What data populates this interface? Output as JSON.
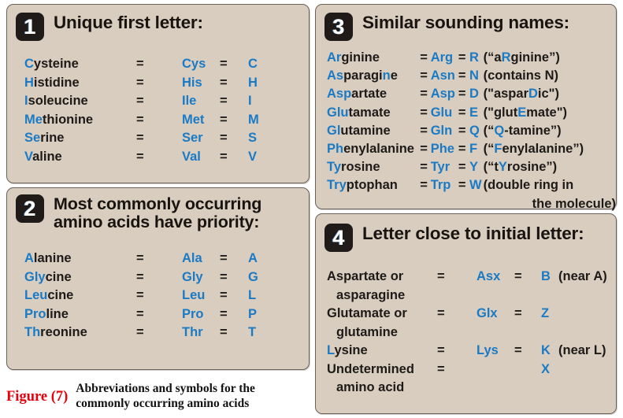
{
  "figure": {
    "label": "Figure (7)",
    "caption_line1": "Abbreviations and symbols for the",
    "caption_line2": "commonly occurring amino acids",
    "label_color": "#e8000d"
  },
  "colors": {
    "panel_background": "#d9cdc0",
    "panel_border": "#6d6258",
    "badge_background": "#201b18",
    "accent_blue": "#1b7ac4",
    "text_dark": "#1d1a17",
    "page_background": "#ffffff"
  },
  "panels": [
    {
      "number": "1",
      "title": "Unique first letter:",
      "rows": [
        {
          "prefix": "C",
          "rest": "ysteine",
          "eq1": "=",
          "abbr": "Cys",
          "eq2": "=",
          "letter": "C"
        },
        {
          "prefix": "H",
          "rest": "istidine",
          "eq1": "=",
          "abbr": "His",
          "eq2": "=",
          "letter": "H"
        },
        {
          "prefix": "I",
          "rest": "soleucine",
          "eq1": "=",
          "abbr": "Ile",
          "eq2": "=",
          "letter": "I"
        },
        {
          "prefix": "Me",
          "rest": "thionine",
          "eq1": "=",
          "abbr": "Met",
          "eq2": "=",
          "letter": "M"
        },
        {
          "prefix": "Se",
          "rest": "rine",
          "eq1": "=",
          "abbr": "Ser",
          "eq2": "=",
          "letter": "S"
        },
        {
          "prefix": "V",
          "rest": "aline",
          "eq1": "=",
          "abbr": "Val",
          "eq2": "=",
          "letter": "V"
        }
      ]
    },
    {
      "number": "2",
      "title_line1": "Most commonly occurring",
      "title_line2": "amino acids have priority:",
      "rows": [
        {
          "prefix": "A",
          "rest": "lanine",
          "eq1": "=",
          "abbr": "Ala",
          "eq2": "=",
          "letter": "A"
        },
        {
          "prefix": "Gly",
          "rest": "cine",
          "eq1": "=",
          "abbr": "Gly",
          "eq2": "=",
          "letter": "G"
        },
        {
          "prefix": "Leu",
          "rest": "cine",
          "eq1": "=",
          "abbr": "Leu",
          "eq2": "=",
          "letter": "L"
        },
        {
          "prefix": "Pro",
          "rest": "line",
          "eq1": "=",
          "abbr": "Pro",
          "eq2": "=",
          "letter": "P"
        },
        {
          "prefix": "Th",
          "rest": "reonine",
          "eq1": "=",
          "abbr": "Thr",
          "eq2": "=",
          "letter": "T"
        }
      ]
    },
    {
      "number": "3",
      "title": "Similar sounding names:",
      "rows": [
        {
          "prefix": "Ar",
          "rest": "ginine",
          "eq1": "=",
          "abbr": "Arg",
          "eq2": "=",
          "letter": "R",
          "note_pre": "(“a",
          "note_hi": "R",
          "note_post": "ginine”)"
        },
        {
          "prefix": "As",
          "rest": "paragine",
          "mid_hi": "n",
          "eq1": "=",
          "abbr": "Asn",
          "eq2": "=",
          "letter": "N",
          "note_pre": "(contains N)",
          "note_hi": "",
          "note_post": ""
        },
        {
          "prefix": "Asp",
          "rest": "artate",
          "eq1": "=",
          "abbr": "Asp",
          "eq2": "=",
          "letter": "D",
          "note_pre": "(\"aspar",
          "note_hi": "D",
          "note_post": "ic\")"
        },
        {
          "prefix": "Glu",
          "rest": "tamate",
          "eq1": "=",
          "abbr": "Glu",
          "eq2": "=",
          "letter": "E",
          "note_pre": "(\"glut",
          "note_hi": "E",
          "note_post": "mate\")"
        },
        {
          "prefix": "Gl",
          "rest": "utamine",
          "eq1": "=",
          "abbr": "Gln",
          "eq2": "=",
          "letter": "Q",
          "note_pre": "(“",
          "note_hi": "Q",
          "note_post": "-tamine”)"
        },
        {
          "prefix": "Ph",
          "rest": "enylalanine",
          "eq1": "=",
          "abbr": "Phe",
          "eq2": "=",
          "letter": "F",
          "note_pre": "(“",
          "note_hi": "F",
          "note_post": "enylalanine”)"
        },
        {
          "prefix": "Ty",
          "rest": "rosine",
          "eq1": "=",
          "abbr": "Tyr",
          "eq2": "=",
          "letter": "Y",
          "note_pre": "(“t",
          "note_hi": "Y",
          "note_post": "rosine”)"
        },
        {
          "prefix": "Try",
          "rest": "ptophan",
          "eq1": "=",
          "abbr": "Trp",
          "eq2": "=",
          "letter": "W",
          "note_pre": "(double ring in",
          "note_hi": "",
          "note_post": "",
          "note_cont": "the molecule)"
        }
      ]
    },
    {
      "number": "4",
      "title": "Letter close to initial letter:",
      "rows": [
        {
          "prefix": "",
          "rest": "Aspartate or",
          "cont": "asparagine",
          "eq1": "=",
          "abbr": "Asx",
          "eq2": "=",
          "letter": "B",
          "note": "(near A)"
        },
        {
          "prefix": "",
          "rest": "Glutamate or",
          "cont": "glutamine",
          "eq1": "=",
          "abbr": "Glx",
          "eq2": "=",
          "letter": "Z",
          "note": ""
        },
        {
          "prefix": "L",
          "rest": "ysine",
          "cont": "",
          "eq1": "=",
          "abbr": "Lys",
          "eq2": "=",
          "letter": "K",
          "note": "(near L)"
        },
        {
          "prefix": "",
          "rest": "Undetermined",
          "cont": "amino acid",
          "eq1": "=",
          "abbr": "",
          "eq2": "",
          "letter": "X",
          "note": ""
        }
      ]
    }
  ]
}
